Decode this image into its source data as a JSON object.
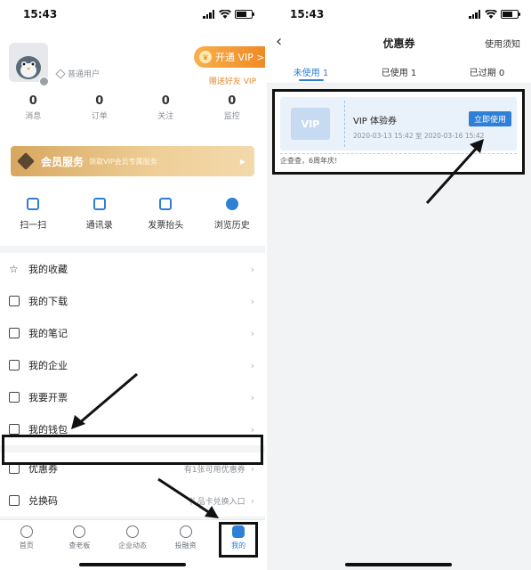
{
  "left": {
    "status": {
      "time": "15:43"
    },
    "profile": {
      "level": "普通用户",
      "vip_button": "开通 VIP >",
      "gift_link": "赠送好友 VIP"
    },
    "stats": [
      {
        "num": "0",
        "label": "消息"
      },
      {
        "num": "0",
        "label": "订单"
      },
      {
        "num": "0",
        "label": "关注"
      },
      {
        "num": "0",
        "label": "监控"
      }
    ],
    "member": {
      "title": "会员服务",
      "subtitle": "领取VIP会员专属服务",
      "arrow": "▶"
    },
    "quick": [
      {
        "label": "扫一扫",
        "icon": "scan-icon"
      },
      {
        "label": "通讯录",
        "icon": "contacts-icon"
      },
      {
        "label": "发票抬头",
        "icon": "invoice-title-icon"
      },
      {
        "label": "浏览历史",
        "icon": "history-icon"
      }
    ],
    "menu": [
      {
        "label": "我的收藏",
        "icon": "star-icon",
        "right": ""
      },
      {
        "label": "我的下载",
        "icon": "download-icon",
        "right": ""
      },
      {
        "label": "我的笔记",
        "icon": "note-icon",
        "right": ""
      },
      {
        "label": "我的企业",
        "icon": "building-icon",
        "right": ""
      },
      {
        "label": "我要开票",
        "icon": "ticket-icon",
        "right": ""
      },
      {
        "label": "我的钱包",
        "icon": "wallet-icon",
        "right": ""
      }
    ],
    "menu2": [
      {
        "label": "优惠券",
        "icon": "coupon-icon",
        "right": "有1张可用优惠券"
      },
      {
        "label": "兑换码",
        "icon": "gift-icon",
        "right": "礼品卡兑换入口"
      }
    ],
    "tabs": [
      {
        "label": "首页",
        "icon": "home-icon"
      },
      {
        "label": "查老板",
        "icon": "boss-icon"
      },
      {
        "label": "企业动态",
        "icon": "news-icon"
      },
      {
        "label": "投融资",
        "icon": "finance-icon"
      },
      {
        "label": "我的",
        "icon": "user-icon"
      }
    ]
  },
  "right": {
    "status": {
      "time": "15:43"
    },
    "header": {
      "back": "‹",
      "title": "优惠券",
      "help": "使用须知"
    },
    "tabs": [
      {
        "label": "未使用 1"
      },
      {
        "label": "已使用 1"
      },
      {
        "label": "已过期 0"
      }
    ],
    "coupon": {
      "image_text": "VIP",
      "title": "VIP 体验券",
      "date": "2020-03-13 15:42 至 2020-03-16 15:42",
      "button": "立即使用",
      "footer": "企查查，6周年庆!"
    }
  },
  "colors": {
    "accent": "#2f7fd6",
    "vip": "#f08a24",
    "gold": "#d7a760"
  }
}
